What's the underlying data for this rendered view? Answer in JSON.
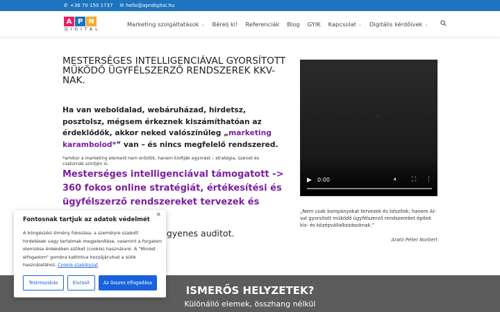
{
  "topbar": {
    "phone": "+36 70 150 1737",
    "email": "hello@apndigital.hu",
    "phone_icon": "phone-icon",
    "email_icon": "envelope-icon"
  },
  "logo": {
    "letters": [
      "A",
      "P",
      "N"
    ],
    "colors": [
      "#e91e63",
      "#1e73be",
      "#f9a825"
    ],
    "subtitle": "DIGITAL"
  },
  "nav": {
    "items": [
      {
        "label": "Marketing szolgáltatások",
        "has_dropdown": true
      },
      {
        "label": "Bérelj ki!",
        "has_dropdown": false
      },
      {
        "label": "Referenciák",
        "has_dropdown": false
      },
      {
        "label": "Blog",
        "has_dropdown": false
      },
      {
        "label": "GYIK",
        "has_dropdown": false
      },
      {
        "label": "Kapcsolat",
        "has_dropdown": true
      },
      {
        "label": "Digitális kérdőívek",
        "has_dropdown": true
      }
    ],
    "search_icon": "search-icon"
  },
  "hero": {
    "title": "MESTERSÉGES INTELLIGENCIÁVAL GYORSÍTOTT MŰKÖDŐ ÜGYFÉLSZERZŐ RENDSZEREK KKV-NAK.",
    "lead_part1": "Ha van weboldalad, webáruházad, hirdetsz, posztolsz, mégsem érkeznek kiszámíthatóan az érdeklődők, akkor neked valószínűleg „",
    "lead_highlight": "marketing karambolod*",
    "lead_part2": "” van – és nincs megfelelő rendszered.",
    "footnote": "*amikor a marketing elemeid nem erősítik, hanem kioltják egymást – stratégia, üzenet és csatornák szintjén is.",
    "mi_heading": "Mesterséges intelligenciával támogatott -> 360 fokos online stratégiát, értékesítési és ügyfélszerző rendszereket tervezek és",
    "audit_text": "ngyenes auditot."
  },
  "video": {
    "time": "0:00",
    "play_icon": "play-icon",
    "volume_icon": "volume-icon",
    "fullscreen_icon": "fullscreen-icon",
    "more_icon": "more-vertical-icon"
  },
  "quote": {
    "text": "„Nem csak kampányokat tervezek és készítek, hanem AI-val gyorsított működő ügyfélszerző rendszereket építek kis- és középvállalkozásoknak.”",
    "author": "Arató Péter Norbert"
  },
  "band": {
    "title": "ISMERŐS HELYZETEK?",
    "subtitle": "Különálló elemek, összhang nélkül"
  },
  "cookie": {
    "title": "Fontosnak tartjuk az adatok védelmét",
    "body": "A böngészési élmény fokozása, a személyre szabott hirdetések vagy tartalmak megjelenítése, valamint a forgalom elemzése érdekében sütiket (cookie) használunk. A \"Mindet elfogadom\" gombra kattintva hozzájárulhat a sütik használatához.",
    "link": "Cookie-szabályzat",
    "close": "×",
    "btn_customize": "Testreszabás",
    "btn_reject": "Elutasít",
    "btn_accept": "Az összes elfogadása"
  }
}
